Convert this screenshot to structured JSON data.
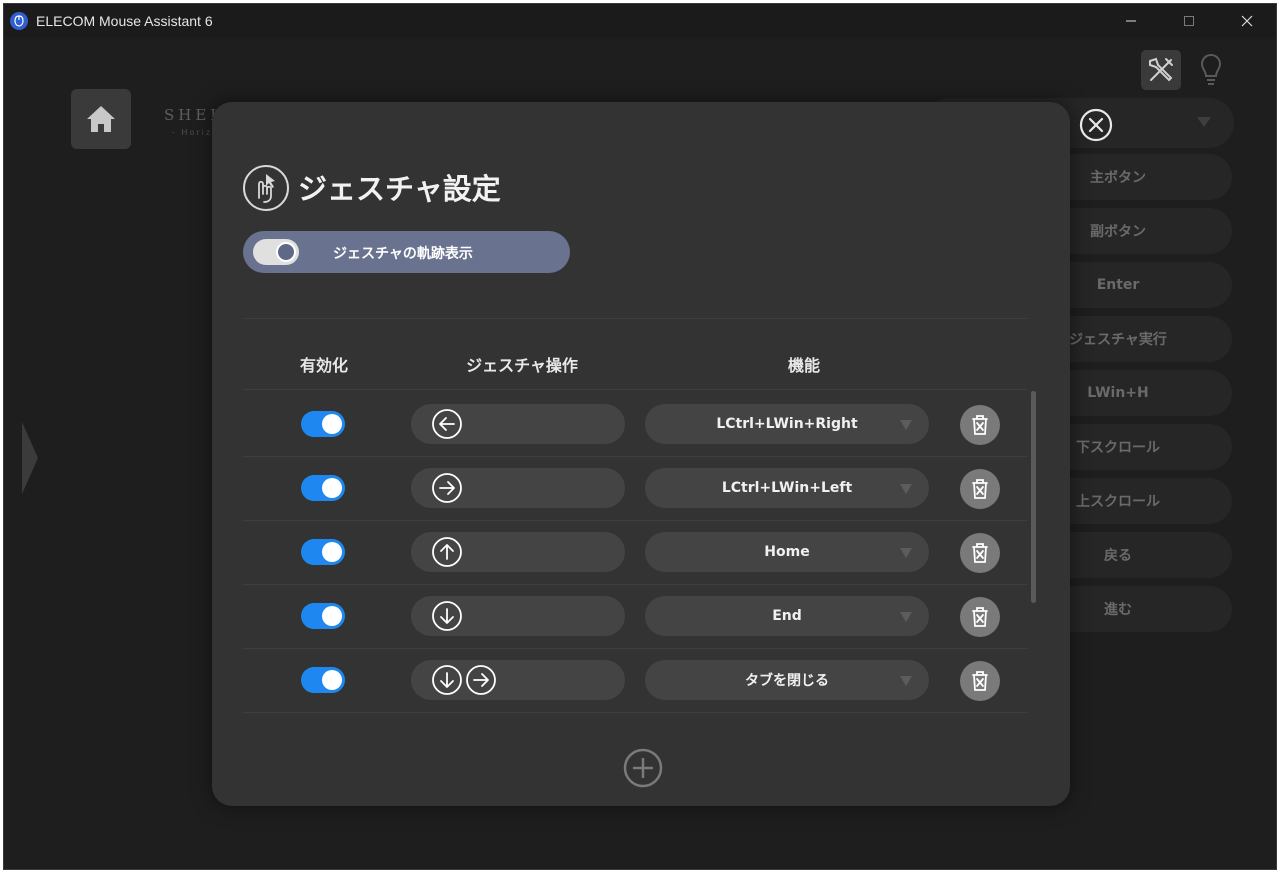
{
  "window": {
    "title": "ELECOM Mouse Assistant 6"
  },
  "background": {
    "brand": "SHEL",
    "brand_sub": "- Horiz",
    "side_items": [
      "主ボタン",
      "副ボタン",
      "Enter",
      "ジェスチャ実行",
      "LWin+H",
      "下スクロール",
      "上スクロール",
      "戻る",
      "進む"
    ]
  },
  "modal": {
    "title": "ジェスチャ設定",
    "trail_toggle_label": "ジェスチャの軌跡表示",
    "columns": {
      "enable": "有効化",
      "gesture": "ジェスチャ操作",
      "function": "機能"
    },
    "rows": [
      {
        "enabled": true,
        "gesture": [
          "left"
        ],
        "function": "LCtrl+LWin+Right"
      },
      {
        "enabled": true,
        "gesture": [
          "right"
        ],
        "function": "LCtrl+LWin+Left"
      },
      {
        "enabled": true,
        "gesture": [
          "up"
        ],
        "function": "Home"
      },
      {
        "enabled": true,
        "gesture": [
          "down"
        ],
        "function": "End"
      },
      {
        "enabled": true,
        "gesture": [
          "down",
          "right"
        ],
        "function": "タブを閉じる"
      }
    ]
  },
  "colors": {
    "accent_toggle": "#1e88f0",
    "trail_toggle_bg": "#69738f",
    "modal_bg": "#333333"
  }
}
